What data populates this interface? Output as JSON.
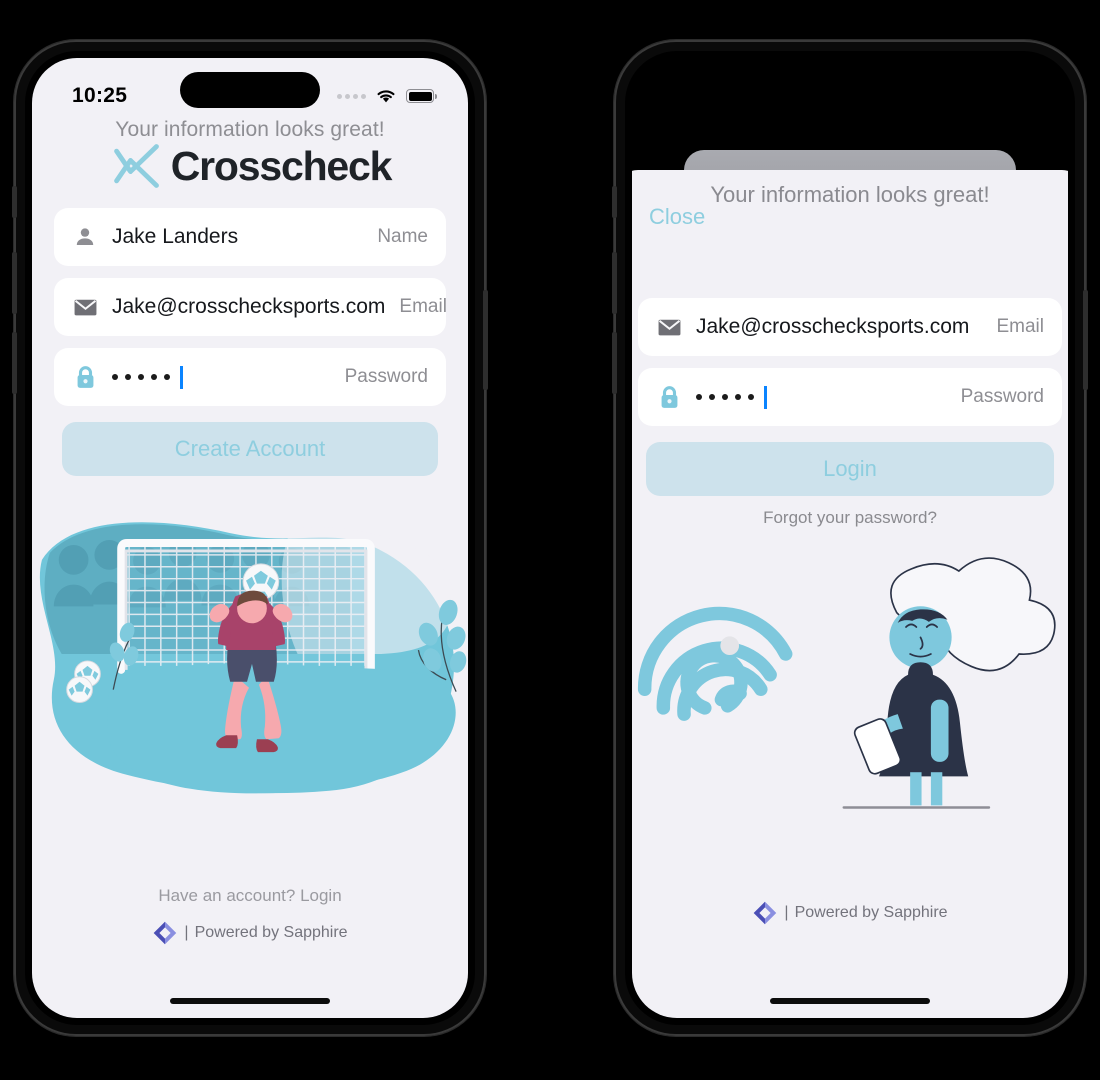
{
  "screen_left": {
    "status_bar": {
      "time": "10:25",
      "signal_icon": "signal-dots-icon",
      "wifi_icon": "wifi-icon",
      "battery_icon": "battery-icon"
    },
    "headline": "Your information looks great!",
    "brand": {
      "name": "Crosscheck",
      "mark_icon": "crosscheck-x-logo-icon",
      "mark_color": "#8ecedf",
      "name_color": "#1f2328"
    },
    "fields": [
      {
        "icon": "person-icon",
        "icon_color": "#8e8e93",
        "value": "Jake Landers",
        "label": "Name",
        "type": "text"
      },
      {
        "icon": "envelope-icon",
        "icon_color": "#6f6f75",
        "value": "Jake@crosschecksports.com",
        "label": "Email",
        "type": "email"
      },
      {
        "icon": "lock-icon",
        "icon_color": "#7ec8dd",
        "value": "•••••",
        "dots": 5,
        "label": "Password",
        "type": "password",
        "caret": true
      }
    ],
    "cta": {
      "label": "Create Account",
      "bg": "#cde2ec",
      "text_color": "#8ecedf"
    },
    "illustration": "soccer-goalkeeper-illustration",
    "have_account": "Have an account? Login",
    "powered_by": {
      "separator": "|",
      "text": "Powered by Sapphire",
      "logo_icon": "sapphire-diamond-logo-icon",
      "logo_color": "#4b4fb5"
    }
  },
  "screen_right": {
    "sheet_title": "Your information looks great!",
    "close_label": "Close",
    "close_color": "#8ecedf",
    "fields": [
      {
        "icon": "envelope-icon",
        "icon_color": "#6f6f75",
        "value": "Jake@crosschecksports.com",
        "label": "Email",
        "type": "email"
      },
      {
        "icon": "lock-icon",
        "icon_color": "#7ec8dd",
        "value": "•••••",
        "dots": 5,
        "label": "Password",
        "type": "password",
        "caret": true
      }
    ],
    "cta": {
      "label": "Login",
      "bg": "#cde2ec",
      "text_color": "#8ecedf"
    },
    "forgot_password": "Forgot your password?",
    "illustration": "fingerprint-and-person-with-phone-illustration",
    "powered_by": {
      "separator": "|",
      "text": "Powered by Sapphire",
      "logo_icon": "sapphire-diamond-logo-icon",
      "logo_color": "#4b4fb5"
    }
  },
  "theme": {
    "background": "#000000",
    "screen_bg": "#f2f1f6",
    "accent_teal": "#7ec8dd",
    "accent_light": "#cde2ec",
    "text_dark": "#16181c",
    "text_muted": "#8e8e93"
  }
}
